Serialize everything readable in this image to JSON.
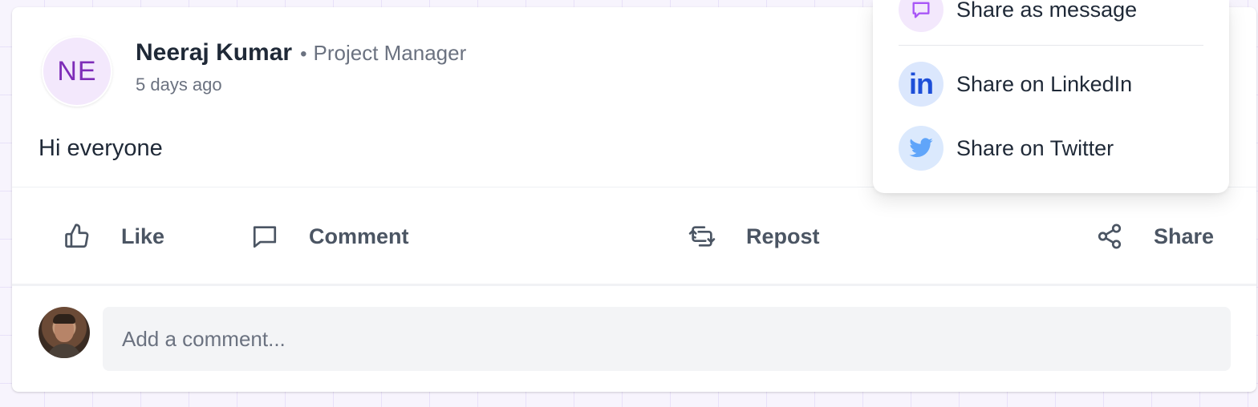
{
  "post": {
    "author_initials": "NE",
    "author_name": "Neeraj Kumar",
    "separator": "•",
    "author_role": "Project Manager",
    "timestamp": "5 days ago",
    "text": "Hi everyone"
  },
  "actions": {
    "like": "Like",
    "comment": "Comment",
    "repost": "Repost",
    "share": "Share"
  },
  "comment_input": {
    "placeholder": "Add a comment..."
  },
  "share_menu": {
    "items": [
      {
        "label": "Share as message",
        "icon": "message-icon"
      },
      {
        "label": "Share on LinkedIn",
        "icon": "linkedin-icon",
        "glyph": "in"
      },
      {
        "label": "Share on Twitter",
        "icon": "twitter-icon"
      }
    ]
  },
  "colors": {
    "avatar_bg": "#f3e8fc",
    "avatar_text": "#7e2db8",
    "linkedin": "#1d4ed8",
    "twitter": "#60a5fa",
    "message_icon": "#a855f7"
  }
}
